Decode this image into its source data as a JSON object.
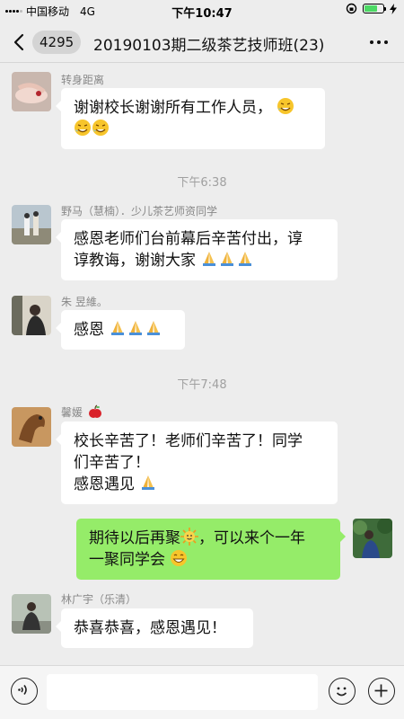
{
  "status_bar": {
    "carrier": "中国移动",
    "network": "4G",
    "time": "下午10:47"
  },
  "nav": {
    "unread_count": "4295",
    "title": "20190103期二级茶艺技师班(23)"
  },
  "messages": [
    {
      "sender": "转身距离",
      "text": "谢谢校长谢谢所有工作人员，",
      "emojis": [
        "grin-sweat-icon",
        "grin-sweat-icon",
        "grin-sweat-icon"
      ]
    },
    {
      "sender": "野马（慧楠）．少儿茶艺师资同学",
      "line1": "感恩老师们台前幕后辛苦付出，谆",
      "line2": "谆教诲，谢谢大家"
    },
    {
      "sender": "朱 昱維。",
      "text": "感恩"
    },
    {
      "sender": "馨媛",
      "line1": "校长辛苦了！老师们辛苦了！同学",
      "line2": "们辛苦了！",
      "line3": "感恩遇见"
    },
    {
      "sender": "me",
      "line1_a": "期待以后再聚",
      "line1_b": "，可以来个一年",
      "line2": "一聚同学会"
    },
    {
      "sender": "林广宇（乐清）",
      "text": "恭喜恭喜，感恩遇见！"
    }
  ],
  "timestamps": [
    "下午6:38",
    "下午7:48"
  ],
  "colors": {
    "background": "#ededed",
    "bubble_mine": "#95ec69",
    "bubble_other": "#ffffff",
    "battery": "#4cd964"
  }
}
